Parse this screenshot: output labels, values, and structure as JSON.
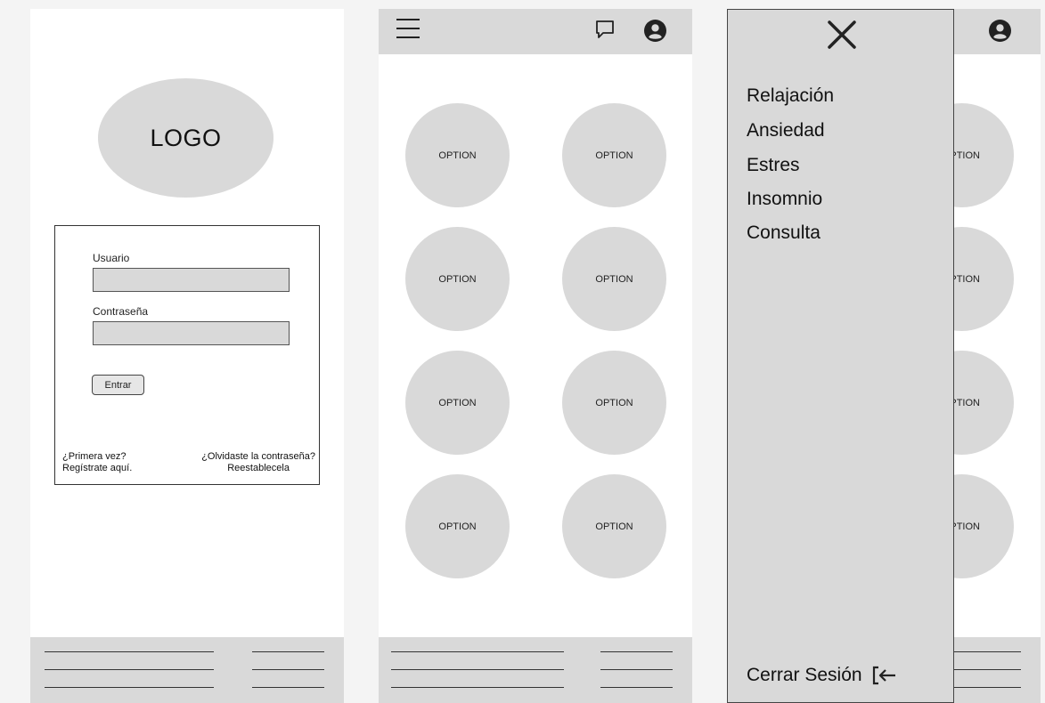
{
  "login": {
    "logo_text": "LOGO",
    "username_label": "Usuario",
    "username_value": "",
    "password_label": "Contraseña",
    "password_value": "",
    "enter_button": "Entrar",
    "register_line1": "¿Primera vez?",
    "register_line2": "Regístrate aquí.",
    "forgot_line1": "¿Olvidaste la contraseña?",
    "forgot_line2": "Reestablecela"
  },
  "home": {
    "options": [
      "OPTION",
      "OPTION",
      "OPTION",
      "OPTION",
      "OPTION",
      "OPTION",
      "OPTION",
      "OPTION"
    ]
  },
  "menu": {
    "items": [
      "Relajación",
      "Ansiedad",
      "Estres",
      "Insomnio",
      "Consulta"
    ],
    "logout_label": "Cerrar Sesión",
    "partial_options": [
      "PTION",
      "PTION",
      "PTION",
      "PTION"
    ]
  },
  "icons": {
    "menu": "hamburger-icon",
    "chat": "chat-icon",
    "user": "user-icon",
    "close": "close-icon",
    "logout": "logout-icon"
  },
  "colors": {
    "placeholder_gray": "#d9d9d9",
    "background": "#f4f4f4",
    "screen": "#ffffff",
    "stroke": "#333333"
  }
}
